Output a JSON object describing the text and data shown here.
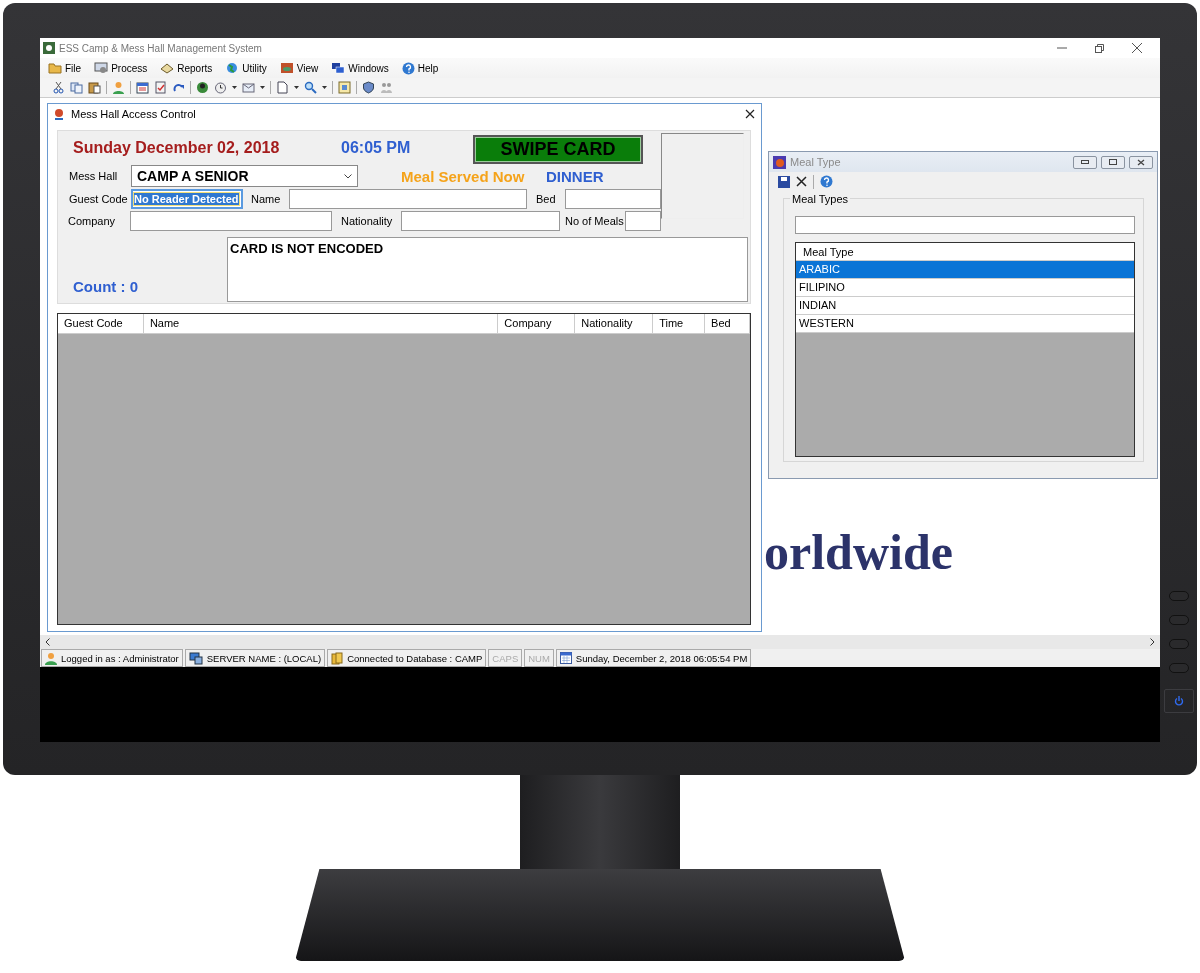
{
  "app": {
    "title": "ESS Camp & Mess Hall Management System",
    "menu": [
      {
        "label": "File"
      },
      {
        "label": "Process"
      },
      {
        "label": "Reports"
      },
      {
        "label": "Utility"
      },
      {
        "label": "View"
      },
      {
        "label": "Windows"
      },
      {
        "label": "Help"
      }
    ],
    "background_logo": "orldwide"
  },
  "mess_window": {
    "title": "Mess Hall Access Control",
    "date": "Sunday December 02, 2018",
    "time": "06:05 PM",
    "swipe_button": "SWIPE CARD",
    "mess_hall": {
      "label": "Mess Hall",
      "value": "CAMP A SENIOR"
    },
    "meal_served_label": "Meal Served Now",
    "meal_served_value": "DINNER",
    "guest_code": {
      "label": "Guest Code",
      "value": "No Reader Detected",
      "selected": true
    },
    "name": {
      "label": "Name"
    },
    "bed": {
      "label": "Bed"
    },
    "company": {
      "label": "Company"
    },
    "nationality": {
      "label": "Nationality"
    },
    "no_of_meals": {
      "label": "No of Meals"
    },
    "count": "Count : 0",
    "message": "CARD IS NOT ENCODED",
    "columns": [
      "Guest Code",
      "Name",
      "Company",
      "Nationality",
      "Time",
      "Bed"
    ]
  },
  "meal_window": {
    "title": "Meal Type",
    "group_label": "Meal Types",
    "column": "Meal Type",
    "items": [
      {
        "label": "ARABIC",
        "selected": true
      },
      {
        "label": "FILIPINO",
        "selected": false
      },
      {
        "label": "INDIAN",
        "selected": false
      },
      {
        "label": "WESTERN",
        "selected": false
      }
    ]
  },
  "status_bar": [
    {
      "kind": "user",
      "text": "Logged in as : Administrator"
    },
    {
      "kind": "server",
      "text": "SERVER NAME : (LOCAL)"
    },
    {
      "kind": "database",
      "text": "Connected to Database : CAMP"
    },
    {
      "kind": "key",
      "text": "CAPS",
      "on": false
    },
    {
      "kind": "key",
      "text": "NUM",
      "on": false
    },
    {
      "kind": "clock",
      "text": "Sunday, December 2, 2018 06:05:54 PM"
    }
  ]
}
